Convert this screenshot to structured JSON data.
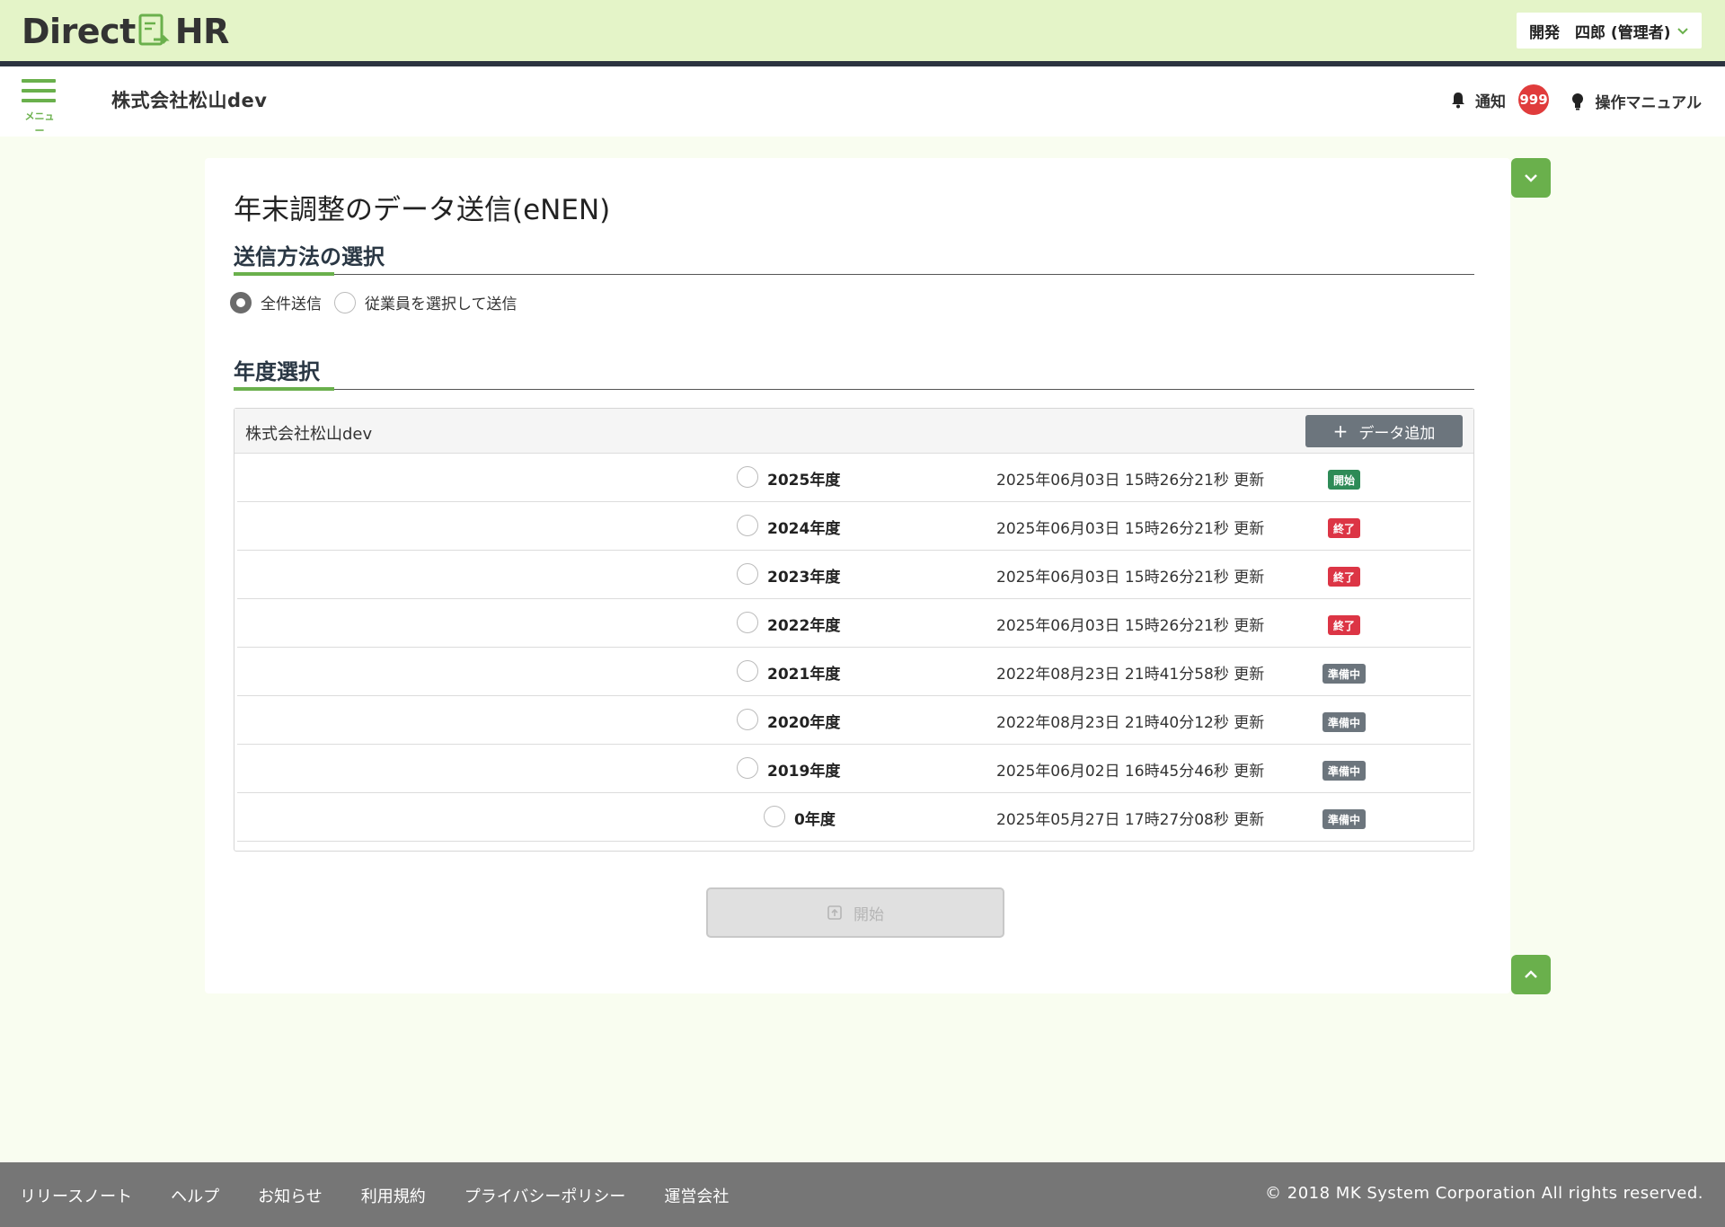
{
  "header": {
    "logo_text_left": "Direct",
    "logo_text_right": "HR",
    "user_label": "開発　四郎 (管理者)",
    "menu_label": "メニュー",
    "company_name": "株式会社松山dev",
    "notify_label": "通知",
    "notify_count": "999",
    "manual_label": "操作マニュアル"
  },
  "page": {
    "title": "年末調整のデータ送信(eNEN)",
    "send_method_heading": "送信方法の選択",
    "send_options": [
      {
        "label": "全件送信",
        "checked": true
      },
      {
        "label": "従業員を選択して送信",
        "checked": false
      }
    ],
    "year_heading": "年度選択",
    "panel_company": "株式会社松山dev",
    "add_button_plus": "+",
    "add_button_label": "データ追加",
    "rows": [
      {
        "year": "2025年度",
        "updated": "2025年06月03日 15時26分21秒 更新",
        "status": "開始",
        "status_type": "start"
      },
      {
        "year": "2024年度",
        "updated": "2025年06月03日 15時26分21秒 更新",
        "status": "終了",
        "status_type": "end"
      },
      {
        "year": "2023年度",
        "updated": "2025年06月03日 15時26分21秒 更新",
        "status": "終了",
        "status_type": "end"
      },
      {
        "year": "2022年度",
        "updated": "2025年06月03日 15時26分21秒 更新",
        "status": "終了",
        "status_type": "end"
      },
      {
        "year": "2021年度",
        "updated": "2022年08月23日 21時41分58秒 更新",
        "status": "準備中",
        "status_type": "prep"
      },
      {
        "year": "2020年度",
        "updated": "2022年08月23日 21時40分12秒 更新",
        "status": "準備中",
        "status_type": "prep"
      },
      {
        "year": "2019年度",
        "updated": "2025年06月02日 16時45分46秒 更新",
        "status": "準備中",
        "status_type": "prep"
      },
      {
        "year": "0年度",
        "updated": "2025年05月27日 17時27分08秒 更新",
        "status": "準備中",
        "status_type": "prep"
      }
    ],
    "start_button_label": "開始"
  },
  "colors": {
    "accent": "#6ab04c",
    "status_start": "#2e8b57",
    "status_end": "#dc3545",
    "status_prep": "#6c757d"
  },
  "footer": {
    "links": [
      "リリースノート",
      "ヘルプ",
      "お知らせ",
      "利用規約",
      "プライバシーポリシー",
      "運営会社"
    ],
    "copyright": "© 2018 MK System Corporation All rights reserved."
  }
}
